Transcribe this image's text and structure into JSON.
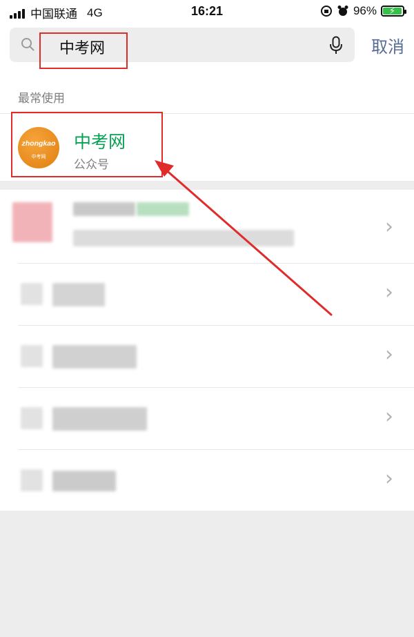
{
  "status_bar": {
    "carrier": "中国联通",
    "network": "4G",
    "time": "16:21",
    "battery_percent": "96%",
    "battery_level": 0.96,
    "icons": [
      "signal-icon",
      "orientation-lock-icon",
      "alarm-icon",
      "battery-charging-icon"
    ]
  },
  "search": {
    "query": "中考网",
    "cancel_label": "取消",
    "icons": [
      "search-icon",
      "mic-icon"
    ]
  },
  "section": {
    "label": "最常使用",
    "result": {
      "title": "中考网",
      "subtitle": "公众号",
      "avatar_text": "zhongkao",
      "avatar_subtext": "中考网"
    }
  },
  "list": {
    "rows": 5,
    "icons": [
      "chevron-right-icon"
    ]
  },
  "colors": {
    "highlight": "#e02b2b",
    "title_green": "#07a054",
    "link_blue": "#576b95"
  }
}
